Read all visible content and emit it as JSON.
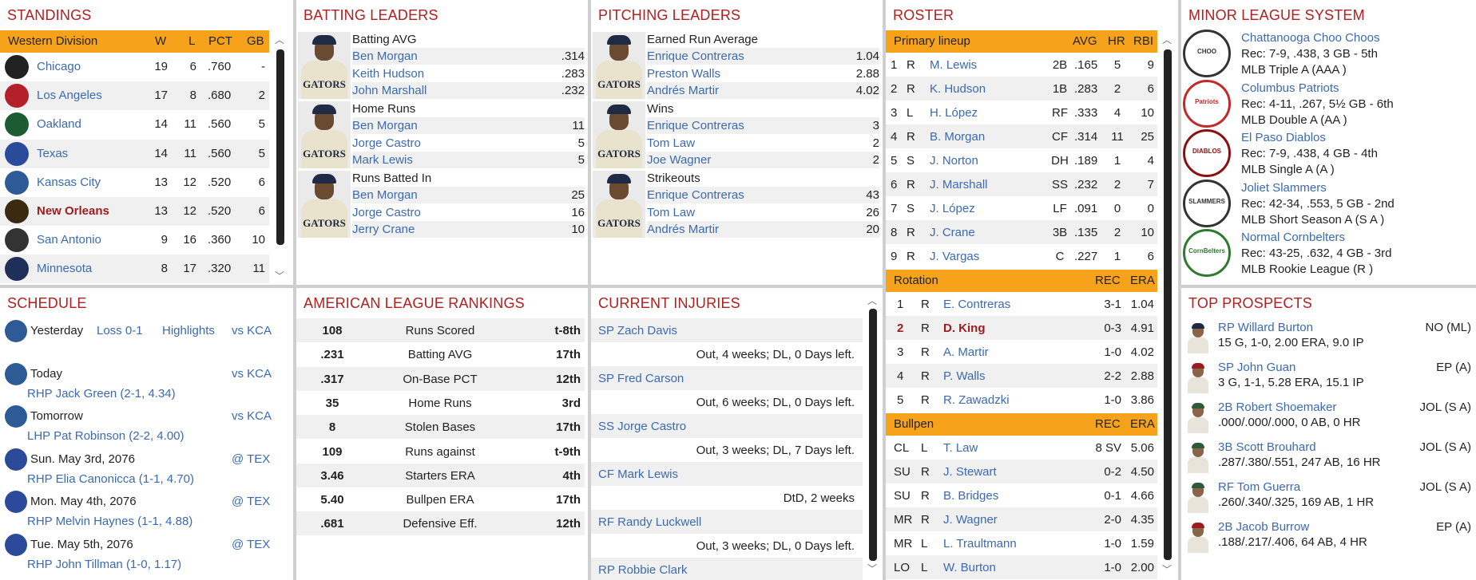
{
  "standings": {
    "title": "STANDINGS",
    "header": {
      "division": "Western Division",
      "w": "W",
      "l": "L",
      "pct": "PCT",
      "gb": "GB"
    },
    "teams": [
      {
        "name": "Chicago",
        "w": "19",
        "l": "6",
        "pct": ".760",
        "gb": "-",
        "color": "#222222",
        "bold": false
      },
      {
        "name": "Los Angeles",
        "w": "17",
        "l": "8",
        "pct": ".680",
        "gb": "2",
        "color": "#b3202a",
        "bold": false
      },
      {
        "name": "Oakland",
        "w": "14",
        "l": "11",
        "pct": ".560",
        "gb": "5",
        "color": "#1d5c33",
        "bold": false
      },
      {
        "name": "Texas",
        "w": "14",
        "l": "11",
        "pct": ".560",
        "gb": "5",
        "color": "#2b4b9a",
        "bold": false
      },
      {
        "name": "Kansas City",
        "w": "13",
        "l": "12",
        "pct": ".520",
        "gb": "6",
        "color": "#2e5a96",
        "bold": false
      },
      {
        "name": "New Orleans",
        "w": "13",
        "l": "12",
        "pct": ".520",
        "gb": "6",
        "color": "#3a2a10",
        "bold": true
      },
      {
        "name": "San Antonio",
        "w": "9",
        "l": "16",
        "pct": ".360",
        "gb": "10",
        "color": "#333333",
        "bold": false
      },
      {
        "name": "Minnesota",
        "w": "8",
        "l": "17",
        "pct": ".320",
        "gb": "11",
        "color": "#1f2f5a",
        "bold": false
      }
    ]
  },
  "batting": {
    "title": "BATTING LEADERS",
    "groups": [
      {
        "stat": "Batting AVG",
        "rows": [
          {
            "name": "Ben Morgan",
            "val": ".314"
          },
          {
            "name": "Keith Hudson",
            "val": ".283"
          },
          {
            "name": "John Marshall",
            "val": ".232"
          }
        ]
      },
      {
        "stat": "Home Runs",
        "rows": [
          {
            "name": "Ben Morgan",
            "val": "11"
          },
          {
            "name": "Jorge Castro",
            "val": "5"
          },
          {
            "name": "Mark Lewis",
            "val": "5"
          }
        ]
      },
      {
        "stat": "Runs Batted In",
        "rows": [
          {
            "name": "Ben Morgan",
            "val": "25"
          },
          {
            "name": "Jorge Castro",
            "val": "16"
          },
          {
            "name": "Jerry Crane",
            "val": "10"
          }
        ]
      }
    ],
    "photo_text": "GATORS"
  },
  "pitching": {
    "title": "PITCHING LEADERS",
    "groups": [
      {
        "stat": "Earned Run Average",
        "rows": [
          {
            "name": "Enrique Contreras",
            "val": "1.04"
          },
          {
            "name": "Preston Walls",
            "val": "2.88"
          },
          {
            "name": "Andrés Martir",
            "val": "4.02"
          }
        ]
      },
      {
        "stat": "Wins",
        "rows": [
          {
            "name": "Enrique Contreras",
            "val": "3"
          },
          {
            "name": "Tom Law",
            "val": "2"
          },
          {
            "name": "Joe Wagner",
            "val": "2"
          }
        ]
      },
      {
        "stat": "Strikeouts",
        "rows": [
          {
            "name": "Enrique Contreras",
            "val": "43"
          },
          {
            "name": "Tom Law",
            "val": "26"
          },
          {
            "name": "Andrés Martir",
            "val": "20"
          }
        ]
      }
    ],
    "photo_text": "GATORS"
  },
  "roster": {
    "title": "ROSTER",
    "lineup_header": {
      "label": "Primary lineup",
      "avg": "AVG",
      "hr": "HR",
      "rbi": "RBI"
    },
    "lineup": [
      {
        "n": "1",
        "h": "R",
        "name": "M. Lewis",
        "pos": "2B",
        "avg": ".165",
        "hr": "5",
        "rbi": "9"
      },
      {
        "n": "2",
        "h": "R",
        "name": "K. Hudson",
        "pos": "1B",
        "avg": ".283",
        "hr": "2",
        "rbi": "6"
      },
      {
        "n": "3",
        "h": "L",
        "name": "H. López",
        "pos": "RF",
        "avg": ".333",
        "hr": "4",
        "rbi": "10"
      },
      {
        "n": "4",
        "h": "R",
        "name": "B. Morgan",
        "pos": "CF",
        "avg": ".314",
        "hr": "11",
        "rbi": "25"
      },
      {
        "n": "5",
        "h": "S",
        "name": "J. Norton",
        "pos": "DH",
        "avg": ".189",
        "hr": "1",
        "rbi": "4"
      },
      {
        "n": "6",
        "h": "R",
        "name": "J. Marshall",
        "pos": "SS",
        "avg": ".232",
        "hr": "2",
        "rbi": "7"
      },
      {
        "n": "7",
        "h": "S",
        "name": "J. López",
        "pos": "LF",
        "avg": ".091",
        "hr": "0",
        "rbi": "0"
      },
      {
        "n": "8",
        "h": "R",
        "name": "J. Crane",
        "pos": "3B",
        "avg": ".135",
        "hr": "2",
        "rbi": "10"
      },
      {
        "n": "9",
        "h": "R",
        "name": "J. Vargas",
        "pos": "C",
        "avg": ".227",
        "hr": "1",
        "rbi": "6"
      }
    ],
    "rotation_header": {
      "label": "Rotation",
      "rec": "REC",
      "era": "ERA"
    },
    "rotation": [
      {
        "n": "1",
        "h": "R",
        "name": "E. Contreras",
        "rec": "3-1",
        "era": "1.04",
        "hl": false
      },
      {
        "n": "2",
        "h": "R",
        "name": "D. King",
        "rec": "0-3",
        "era": "4.91",
        "hl": true
      },
      {
        "n": "3",
        "h": "R",
        "name": "A. Martir",
        "rec": "1-0",
        "era": "4.02",
        "hl": false
      },
      {
        "n": "4",
        "h": "R",
        "name": "P. Walls",
        "rec": "2-2",
        "era": "2.88",
        "hl": false
      },
      {
        "n": "5",
        "h": "R",
        "name": "R. Zawadzki",
        "rec": "1-0",
        "era": "3.86",
        "hl": false
      }
    ],
    "bullpen_header": {
      "label": "Bullpen",
      "rec": "REC",
      "era": "ERA"
    },
    "bullpen": [
      {
        "role": "CL",
        "h": "L",
        "name": "T. Law",
        "rec": "8 SV",
        "era": "5.06"
      },
      {
        "role": "SU",
        "h": "R",
        "name": "J. Stewart",
        "rec": "0-2",
        "era": "4.50"
      },
      {
        "role": "SU",
        "h": "R",
        "name": "B. Bridges",
        "rec": "0-1",
        "era": "4.66"
      },
      {
        "role": "MR",
        "h": "R",
        "name": "J. Wagner",
        "rec": "2-0",
        "era": "4.35"
      },
      {
        "role": "MR",
        "h": "L",
        "name": "L. Traultmann",
        "rec": "1-0",
        "era": "1.59"
      },
      {
        "role": "LO",
        "h": "L",
        "name": "W. Burton",
        "rec": "1-0",
        "era": "2.00"
      }
    ]
  },
  "minors": {
    "title": "MINOR LEAGUE SYSTEM",
    "teams": [
      {
        "name": "Chattanooga Choo Choos",
        "rec": "Rec: 7-9, .438, 3 GB - 5th",
        "level": "MLB Triple A (AAA )",
        "color": "#333333",
        "logo_text": "CHOO"
      },
      {
        "name": "Columbus Patriots",
        "rec": "Rec: 4-11, .267, 5½ GB - 6th",
        "level": "MLB Double A (AA )",
        "color": "#c22a2a",
        "logo_text": "Patriots"
      },
      {
        "name": "El Paso Diablos",
        "rec": "Rec: 7-9, .438, 4 GB - 4th",
        "level": "MLB Single A (A )",
        "color": "#8a1010",
        "logo_text": "DIABLOS"
      },
      {
        "name": "Joliet Slammers",
        "rec": "Rec: 42-34, .553, 5 GB - 2nd",
        "level": "MLB Short Season A (S A )",
        "color": "#333333",
        "logo_text": "SLAMMERS"
      },
      {
        "name": "Normal Cornbelters",
        "rec": "Rec: 43-25, .632, 4 GB - 3rd",
        "level": "MLB Rookie League (R )",
        "color": "#2f7a2f",
        "logo_text": "CornBelters"
      }
    ]
  },
  "schedule": {
    "title": "SCHEDULE",
    "items": [
      {
        "day": "Yesterday",
        "result": "Loss 0-1",
        "highlights": "Highlights",
        "opp": "vs KCA",
        "pitcher": ""
      },
      {
        "day": "Today",
        "result": "",
        "highlights": "",
        "opp": "vs KCA",
        "pitcher": "RHP Jack Green (2-1, 4.34)"
      },
      {
        "day": "Tomorrow",
        "result": "",
        "highlights": "",
        "opp": "vs KCA",
        "pitcher": "LHP Pat Robinson (2-2, 4.00)"
      },
      {
        "day": "Sun. May 3rd, 2076",
        "result": "",
        "highlights": "",
        "opp": "@ TEX",
        "pitcher": "RHP Elia Canonicca (1-1, 4.70)"
      },
      {
        "day": "Mon. May 4th, 2076",
        "result": "",
        "highlights": "",
        "opp": "@ TEX",
        "pitcher": "RHP Melvin Haynes (1-1, 4.88)"
      },
      {
        "day": "Tue. May 5th, 2076",
        "result": "",
        "highlights": "",
        "opp": "@ TEX",
        "pitcher": "RHP John Tillman (1-0, 1.17)"
      }
    ]
  },
  "rankings": {
    "title": "AMERICAN LEAGUE RANKINGS",
    "rows": [
      {
        "val": "108",
        "label": "Runs Scored",
        "rank": "t-8th"
      },
      {
        "val": ".231",
        "label": "Batting AVG",
        "rank": "17th"
      },
      {
        "val": ".317",
        "label": "On-Base PCT",
        "rank": "12th"
      },
      {
        "val": "35",
        "label": "Home Runs",
        "rank": "3rd"
      },
      {
        "val": "8",
        "label": "Stolen Bases",
        "rank": "17th"
      },
      {
        "val": "109",
        "label": "Runs against",
        "rank": "t-9th"
      },
      {
        "val": "3.46",
        "label": "Starters ERA",
        "rank": "4th"
      },
      {
        "val": "5.40",
        "label": "Bullpen ERA",
        "rank": "17th"
      },
      {
        "val": ".681",
        "label": "Defensive Eff.",
        "rank": "12th"
      }
    ]
  },
  "injuries": {
    "title": "CURRENT INJURIES",
    "items": [
      {
        "player": "SP Zach Davis",
        "status": "Out, 4 weeks; DL, 0 Days left."
      },
      {
        "player": "SP Fred Carson",
        "status": "Out, 6 weeks; DL, 0 Days left."
      },
      {
        "player": "SS Jorge Castro",
        "status": "Out, 3 weeks; DL, 7 Days left."
      },
      {
        "player": "CF Mark Lewis",
        "status": "DtD, 2 weeks"
      },
      {
        "player": "RF Randy Luckwell",
        "status": "Out, 3 weeks; DL, 0 Days left."
      },
      {
        "player": "RP Robbie Clark",
        "status": ""
      }
    ]
  },
  "prospects": {
    "title": "TOP PROSPECTS",
    "items": [
      {
        "name": "RP Willard Burton",
        "team": "NO (ML)",
        "line": "15 G, 1-0, 2.00 ERA, 9.0 IP",
        "cap": "#1f2a44"
      },
      {
        "name": "SP John Guan",
        "team": "EP (A)",
        "line": "3 G, 1-1, 5.28 ERA, 15.1 IP",
        "cap": "#9b1c1c"
      },
      {
        "name": "2B Robert Shoemaker",
        "team": "JOL (S A)",
        "line": ".000/.000/.000, 0 AB, 0 HR",
        "cap": "#2f5a3a"
      },
      {
        "name": "3B Scott Brouhard",
        "team": "JOL (S A)",
        "line": ".287/.380/.551, 247 AB, 16 HR",
        "cap": "#2f5a3a"
      },
      {
        "name": "RF Tom Guerra",
        "team": "JOL (S A)",
        "line": ".260/.340/.325, 169 AB, 1 HR",
        "cap": "#2f5a3a"
      },
      {
        "name": "2B Jacob Burrow",
        "team": "EP (A)",
        "line": ".188/.217/.406, 64 AB, 4 HR",
        "cap": "#9b1c1c"
      }
    ]
  }
}
